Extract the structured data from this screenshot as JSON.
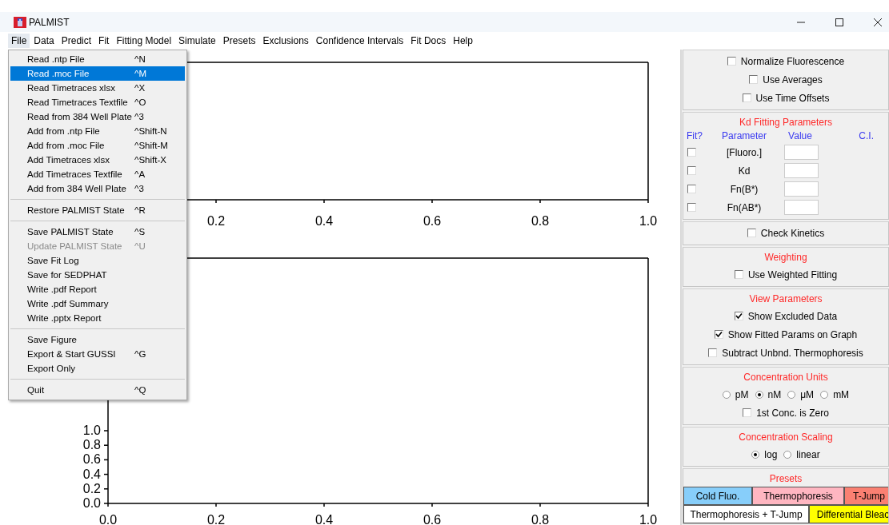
{
  "window": {
    "title": "PALMIST"
  },
  "menu_bar": [
    {
      "label": "File",
      "selected": true
    },
    {
      "label": "Data",
      "selected": false
    },
    {
      "label": "Predict",
      "selected": false
    },
    {
      "label": "Fit",
      "selected": false
    },
    {
      "label": "Fitting Model",
      "selected": false
    },
    {
      "label": "Simulate",
      "selected": false
    },
    {
      "label": "Presets",
      "selected": false
    },
    {
      "label": "Exclusions",
      "selected": false
    },
    {
      "label": "Confidence Intervals",
      "selected": false
    },
    {
      "label": "Fit Docs",
      "selected": false
    },
    {
      "label": "Help",
      "selected": false
    }
  ],
  "file_menu": [
    {
      "kind": "item",
      "label": "Read .ntp File",
      "shortcut": "^N",
      "selected": false,
      "disabled": false
    },
    {
      "kind": "item",
      "label": "Read .moc File",
      "shortcut": "^M",
      "selected": true,
      "disabled": false
    },
    {
      "kind": "item",
      "label": "Read Timetraces xlsx",
      "shortcut": "^X",
      "selected": false,
      "disabled": false
    },
    {
      "kind": "item",
      "label": "Read Timetraces Textfile",
      "shortcut": "^O",
      "selected": false,
      "disabled": false
    },
    {
      "kind": "item",
      "label": "Read from 384 Well Plate",
      "shortcut": "^3",
      "selected": false,
      "disabled": false
    },
    {
      "kind": "item",
      "label": "Add from .ntp File",
      "shortcut": "^Shift-N",
      "selected": false,
      "disabled": false
    },
    {
      "kind": "item",
      "label": "Add from .moc File",
      "shortcut": "^Shift-M",
      "selected": false,
      "disabled": false
    },
    {
      "kind": "item",
      "label": "Add Timetraces xlsx",
      "shortcut": "^Shift-X",
      "selected": false,
      "disabled": false
    },
    {
      "kind": "item",
      "label": "Add Timetraces Textfile",
      "shortcut": "^A",
      "selected": false,
      "disabled": false
    },
    {
      "kind": "item",
      "label": "Add from 384 Well Plate",
      "shortcut": "^3",
      "selected": false,
      "disabled": false
    },
    {
      "kind": "separator"
    },
    {
      "kind": "item",
      "label": "Restore PALMIST State",
      "shortcut": "^R",
      "selected": false,
      "disabled": false
    },
    {
      "kind": "separator"
    },
    {
      "kind": "item",
      "label": "Save PALMIST State",
      "shortcut": "^S",
      "selected": false,
      "disabled": false
    },
    {
      "kind": "item",
      "label": "Update PALMIST State",
      "shortcut": "^U",
      "selected": false,
      "disabled": true
    },
    {
      "kind": "item",
      "label": "Save Fit Log",
      "selected": false,
      "disabled": false
    },
    {
      "kind": "item",
      "label": "Save for SEDPHAT",
      "selected": false,
      "disabled": false
    },
    {
      "kind": "item",
      "label": "Write .pdf Report",
      "selected": false,
      "disabled": false
    },
    {
      "kind": "item",
      "label": "Write .pdf Summary",
      "selected": false,
      "disabled": false
    },
    {
      "kind": "item",
      "label": "Write .pptx Report",
      "selected": false,
      "disabled": false
    },
    {
      "kind": "separator"
    },
    {
      "kind": "item",
      "label": "Save Figure",
      "selected": false,
      "disabled": false
    },
    {
      "kind": "item",
      "label": "Export & Start GUSSI",
      "shortcut": "^G",
      "selected": false,
      "disabled": false
    },
    {
      "kind": "item",
      "label": "Export Only",
      "selected": false,
      "disabled": false
    },
    {
      "kind": "separator"
    },
    {
      "kind": "item",
      "label": "Quit",
      "shortcut": "^Q",
      "selected": false,
      "disabled": false
    }
  ],
  "plots": [
    {
      "x_ticks": [
        "0.2",
        "0.4",
        "0.6",
        "0.8",
        "1.0"
      ]
    },
    {
      "x_ticks": [
        "0.0",
        "0.2",
        "0.4",
        "0.6",
        "0.8",
        "1.0"
      ],
      "y_ticks": [
        "1.0",
        "0.8",
        "0.6",
        "0.4",
        "0.2",
        "0.0"
      ]
    }
  ],
  "display_options": [
    {
      "label": "Normalize Fluorescence",
      "checked": false
    },
    {
      "label": "Use Averages",
      "checked": false
    },
    {
      "label": "Use Time Offsets",
      "checked": false
    }
  ],
  "kd_fitting": {
    "title": "Kd Fitting Parameters",
    "headers": [
      "Fit?",
      "Parameter",
      "Value",
      "C.I."
    ],
    "rows": [
      {
        "name": "[Fluoro.]",
        "fit": false
      },
      {
        "name": "Kd",
        "fit": false
      },
      {
        "name": "Fn(B*)",
        "fit": false
      },
      {
        "name": "Fn(AB*)",
        "fit": false
      }
    ]
  },
  "check_kinetics": {
    "label": "Check Kinetics",
    "checked": false
  },
  "weighting": {
    "title": "Weighting",
    "options": [
      {
        "label": "Use Weighted Fitting",
        "checked": false
      }
    ]
  },
  "view_parameters": {
    "title": "View Parameters",
    "options": [
      {
        "label": "Show Excluded Data",
        "checked": true
      },
      {
        "label": "Show Fitted Params on Graph",
        "checked": true
      },
      {
        "label": "Subtract Unbnd. Thermophoresis",
        "checked": false
      }
    ]
  },
  "concentration_units": {
    "title": "Concentration Units",
    "units": [
      {
        "label": "pM",
        "selected": false
      },
      {
        "label": "nM",
        "selected": true
      },
      {
        "label": "μM",
        "selected": false
      },
      {
        "label": "mM",
        "selected": false
      }
    ],
    "zero_first": {
      "label": "1st Conc. is Zero",
      "checked": false
    }
  },
  "concentration_scaling": {
    "title": "Concentration Scaling",
    "modes": [
      {
        "label": "log",
        "selected": true
      },
      {
        "label": "linear",
        "selected": false
      }
    ]
  },
  "presets": {
    "title": "Presets",
    "rows": [
      [
        {
          "label": "Cold Fluo.",
          "color": "#87cefa"
        },
        {
          "label": "Thermophoresis",
          "color": "#ffb6c1"
        },
        {
          "label": "T-Jump",
          "color": "#fa8072"
        }
      ],
      [
        {
          "label": "Thermophoresis + T-Jump",
          "color": "#ffffff"
        },
        {
          "label": "Differential Bleac",
          "color": "#ffff00"
        }
      ]
    ]
  }
}
